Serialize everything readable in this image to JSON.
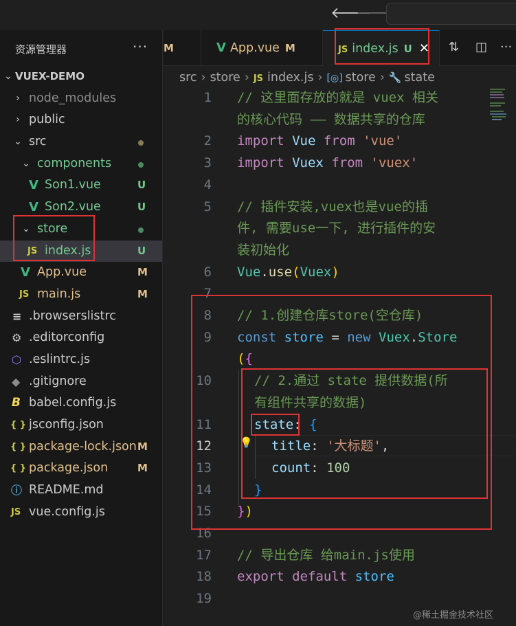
{
  "nav": {
    "back": "🡐",
    "forward": "🡒"
  },
  "explorer": {
    "title": "资源管理器",
    "more": "···",
    "root": "VUEX-DEMO",
    "items": [
      {
        "label": "node_modules",
        "status": ""
      },
      {
        "label": "public",
        "status": ""
      },
      {
        "label": "src",
        "status": ""
      },
      {
        "label": "components",
        "status": ""
      },
      {
        "label": "Son1.vue",
        "status": "U"
      },
      {
        "label": "Son2.vue",
        "status": "U"
      },
      {
        "label": "store",
        "status": ""
      },
      {
        "label": "index.js",
        "status": "U"
      },
      {
        "label": "App.vue",
        "status": "M"
      },
      {
        "label": "main.js",
        "status": "M"
      },
      {
        "label": ".browserslistrc",
        "status": ""
      },
      {
        "label": ".editorconfig",
        "status": ""
      },
      {
        "label": ".eslintrc.js",
        "status": ""
      },
      {
        "label": ".gitignore",
        "status": ""
      },
      {
        "label": "babel.config.js",
        "status": ""
      },
      {
        "label": "jsconfig.json",
        "status": ""
      },
      {
        "label": "package-lock.json",
        "status": "M"
      },
      {
        "label": "package.json",
        "status": "M"
      },
      {
        "label": "README.md",
        "status": ""
      },
      {
        "label": "vue.config.js",
        "status": ""
      }
    ]
  },
  "icons": {
    "vue": "V",
    "js": "JS",
    "json": "{ }",
    "babel": "B",
    "gear": "⚙",
    "eslint": "⬡",
    "git": "◆",
    "info": "ⓘ",
    "lines": "≡",
    "chevron_right": "›",
    "chevron_down": "⌄",
    "close": "✕",
    "bulb": "💡"
  },
  "tabs": [
    {
      "label": "",
      "status": "M"
    },
    {
      "label": "App.vue",
      "status": "M"
    },
    {
      "label": "index.js",
      "status": "U"
    }
  ],
  "breadcrumb": [
    "src",
    "store",
    "index.js",
    "store",
    "state"
  ],
  "code": {
    "line_numbers": [
      "1",
      "2",
      "3",
      "4",
      "5",
      "6",
      "7",
      "8",
      "9",
      "10",
      "11",
      "12",
      "13",
      "14",
      "15",
      "16",
      "17",
      "18",
      "19"
    ],
    "c1a": "// 这里面存放的就是 vuex 相关",
    "c1b": "的核心代码 —— 数据共享的仓库",
    "import": "import",
    "from": "from",
    "vue_cls": "Vue",
    "vue_str": "'vue'",
    "vuex_cls": "Vuex",
    "vuex_str": "'vuex'",
    "c5a": "// 插件安装,vuex也是vue的插",
    "c5b": "件, 需要use一下, 进行插件的安",
    "c5c": "装初始化",
    "use": "use",
    "c8": "// 1.创建仓库store(空仓库)",
    "const": "const",
    "store": "store",
    "new": "new",
    "Store": "Store",
    "c10a": "// 2.通过 state 提供数据(所",
    "c10b": "有组件共享的数据)",
    "state": "state",
    "title": "title",
    "title_val": "'大标题'",
    "count": "count",
    "count_val": "100",
    "c17": "// 导出仓库 给main.js使用",
    "export": "export",
    "default": "default"
  },
  "watermark": "@稀土掘金技术社区"
}
